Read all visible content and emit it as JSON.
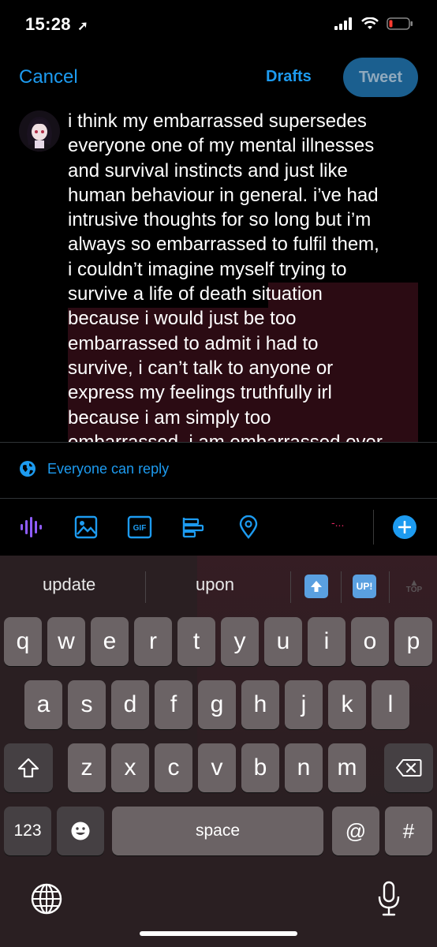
{
  "status": {
    "time": "15:28"
  },
  "header": {
    "cancel": "Cancel",
    "drafts": "Drafts",
    "tweet": "Tweet"
  },
  "compose": {
    "text": "i think my embarrassed supersedes\neveryone one of my mental illnesses\nand survival instincts and just like\nhuman behaviour in general. i’ve had\nintrusive thoughts for so long but i’m\nalways so embarrassed to fulfil them,\ni couldn’t imagine myself trying to\nsurvive a life of death situation\nbecause i would just be too\nembarrassed to admit i had to\nsurvive, i can’t talk to anyone or\nexpress my feelings truthfully irl\nbecause i am simply too\nembarrassed, i am embarrassed over"
  },
  "reply": {
    "label": "Everyone can reply"
  },
  "toolbar": {
    "counter": "-...",
    "icons": [
      "audio-icon",
      "image-icon",
      "gif-icon",
      "poll-icon",
      "location-icon",
      "add-icon"
    ]
  },
  "keyboard": {
    "suggestions": [
      "update",
      "upon"
    ],
    "emoji_suggestions": [
      "⬆️",
      "UP!",
      "TOP"
    ],
    "row1": [
      "q",
      "w",
      "e",
      "r",
      "t",
      "y",
      "u",
      "i",
      "o",
      "p"
    ],
    "row2": [
      "a",
      "s",
      "d",
      "f",
      "g",
      "h",
      "j",
      "k",
      "l"
    ],
    "row3": [
      "z",
      "x",
      "c",
      "v",
      "b",
      "n",
      "m"
    ],
    "numbers_key": "123",
    "space_key": "space",
    "at_key": "@",
    "hash_key": "#"
  },
  "colors": {
    "accent": "#1d9bf0",
    "tweet_button_bg": "#1b5f8f",
    "highlight": "#2b0b13",
    "counter": "#e0245e"
  }
}
